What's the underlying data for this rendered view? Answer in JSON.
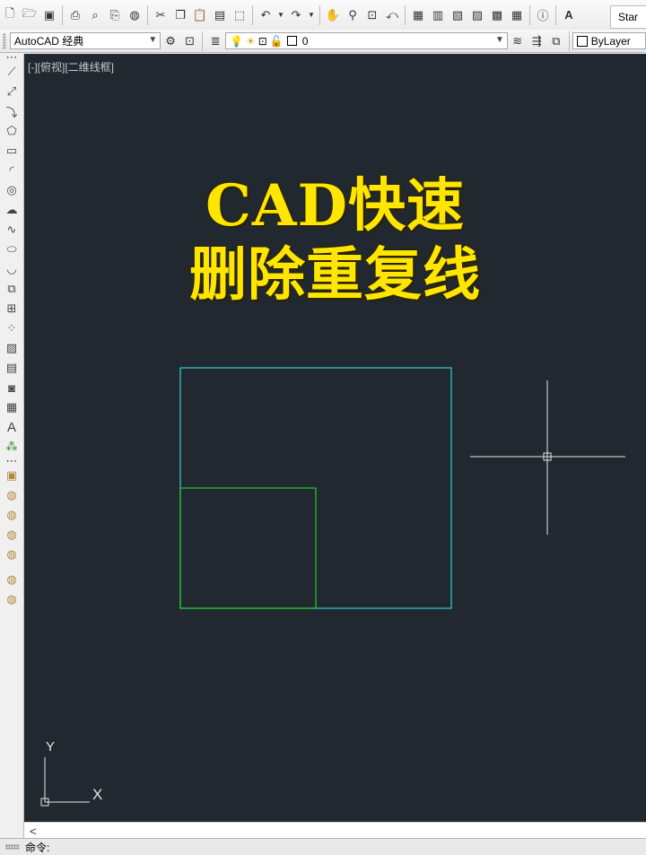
{
  "quick_access": {
    "icons": [
      "new-icon",
      "open-icon",
      "save-icon",
      "plot-icon",
      "plot-preview-icon",
      "publish-icon",
      "3d-dwf-icon",
      "cut-icon",
      "copy-icon",
      "paste-icon",
      "match-properties-icon",
      "block-editor-icon",
      "undo-icon",
      "undo-dropdown-icon",
      "redo-icon",
      "redo-dropdown-icon",
      "pan-icon",
      "zoom-realtime-icon",
      "zoom-window-icon",
      "zoom-previous-icon",
      "properties-icon",
      "design-center-icon",
      "tool-palettes-icon",
      "sheet-set-icon",
      "markup-icon",
      "quickcalc-icon",
      "help-icon",
      "text-style-icon"
    ],
    "start_tab": "Star"
  },
  "workspace": {
    "selected": "AutoCAD 经典",
    "layer_value": "0",
    "color_value": "ByLayer"
  },
  "viewport": {
    "label": "[-][俯视][二维线框]"
  },
  "overlay_title": {
    "line1": "CAD快速",
    "line2": "删除重复线"
  },
  "ucs": {
    "x_label": "X",
    "y_label": "Y"
  },
  "scroll": {
    "left_arrow": "<"
  },
  "command": {
    "prompt": "命令:"
  },
  "colors": {
    "canvas_bg": "#212830",
    "outer_square": "#2fc4c4",
    "inner_square": "#22c02a",
    "title_yellow": "#ffe600"
  }
}
